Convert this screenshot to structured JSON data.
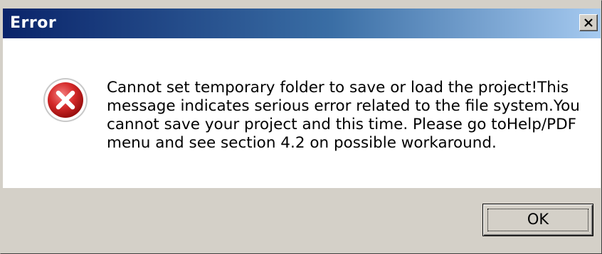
{
  "window": {
    "title": "Error",
    "close_icon": "close-icon"
  },
  "content": {
    "icon": "error-icon",
    "message": "Cannot set temporary folder to save or load the project!This\nmessage indicates serious error related to the file system.You\ncannot save your project and this time. Please go toHelp/PDF\nmenu and see section 4.2 on possible workaround."
  },
  "buttons": {
    "ok_label": "OK"
  },
  "colors": {
    "titlebar_start": "#0a246a",
    "titlebar_end": "#a6caf0",
    "face": "#d4d0c8",
    "error_red": "#cc2020"
  }
}
